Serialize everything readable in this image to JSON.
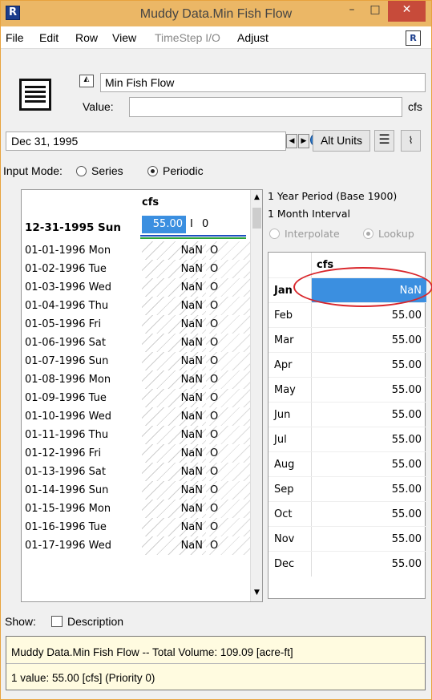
{
  "window": {
    "title": "Muddy Data.Min Fish Flow",
    "min_glyph": "–",
    "max_glyph": "□",
    "close_glyph": "✕"
  },
  "menu": {
    "items": [
      "File",
      "Edit",
      "Row",
      "View",
      "TimeStep I/O",
      "Adjust"
    ]
  },
  "object": {
    "name": "Min Fish Flow",
    "value_label": "Value:",
    "value": "",
    "units": "cfs"
  },
  "toolbar": {
    "date": "Dec 31, 1995",
    "alt_units_label": "Alt Units"
  },
  "input_mode": {
    "label": "Input Mode:",
    "options": [
      "Series",
      "Periodic"
    ],
    "selected": "Periodic"
  },
  "series_table": {
    "units_header": "cfs",
    "current_row": {
      "date": "12-31-1995 Sun",
      "value": "55.00",
      "flag1": "I",
      "flag2": "0"
    },
    "rows": [
      {
        "date": "01-01-1996 Mon",
        "value": "NaN",
        "flag": "O"
      },
      {
        "date": "01-02-1996 Tue",
        "value": "NaN",
        "flag": "O"
      },
      {
        "date": "01-03-1996 Wed",
        "value": "NaN",
        "flag": "O"
      },
      {
        "date": "01-04-1996 Thu",
        "value": "NaN",
        "flag": "O"
      },
      {
        "date": "01-05-1996 Fri",
        "value": "NaN",
        "flag": "O"
      },
      {
        "date": "01-06-1996 Sat",
        "value": "NaN",
        "flag": "O"
      },
      {
        "date": "01-07-1996 Sun",
        "value": "NaN",
        "flag": "O"
      },
      {
        "date": "01-08-1996 Mon",
        "value": "NaN",
        "flag": "O"
      },
      {
        "date": "01-09-1996 Tue",
        "value": "NaN",
        "flag": "O"
      },
      {
        "date": "01-10-1996 Wed",
        "value": "NaN",
        "flag": "O"
      },
      {
        "date": "01-11-1996 Thu",
        "value": "NaN",
        "flag": "O"
      },
      {
        "date": "01-12-1996 Fri",
        "value": "NaN",
        "flag": "O"
      },
      {
        "date": "01-13-1996 Sat",
        "value": "NaN",
        "flag": "O"
      },
      {
        "date": "01-14-1996 Sun",
        "value": "NaN",
        "flag": "O"
      },
      {
        "date": "01-15-1996 Mon",
        "value": "NaN",
        "flag": "O"
      },
      {
        "date": "01-16-1996 Tue",
        "value": "NaN",
        "flag": "O"
      },
      {
        "date": "01-17-1996 Wed",
        "value": "NaN",
        "flag": "O"
      }
    ]
  },
  "periodic": {
    "period_text": "1 Year Period (Base 1900)",
    "interval_text": "1 Month Interval",
    "interp_options": [
      "Interpolate",
      "Lookup"
    ],
    "interp_selected": "Lookup",
    "units_header": "cfs",
    "months": [
      {
        "m": "Jan",
        "v": "NaN"
      },
      {
        "m": "Feb",
        "v": "55.00"
      },
      {
        "m": "Mar",
        "v": "55.00"
      },
      {
        "m": "Apr",
        "v": "55.00"
      },
      {
        "m": "May",
        "v": "55.00"
      },
      {
        "m": "Jun",
        "v": "55.00"
      },
      {
        "m": "Jul",
        "v": "55.00"
      },
      {
        "m": "Aug",
        "v": "55.00"
      },
      {
        "m": "Sep",
        "v": "55.00"
      },
      {
        "m": "Oct",
        "v": "55.00"
      },
      {
        "m": "Nov",
        "v": "55.00"
      },
      {
        "m": "Dec",
        "v": "55.00"
      }
    ]
  },
  "show": {
    "label": "Show:",
    "description_label": "Description",
    "checked": false
  },
  "status": {
    "line1": "Muddy Data.Min Fish Flow -- Total Volume: 109.09 [acre-ft]",
    "line2": "1 value:  55.00 [cfs]  (Priority 0)"
  },
  "colors": {
    "titlebar": "#ebb766",
    "selection": "#3b8fe0",
    "highlight_ring": "#d9262b"
  }
}
